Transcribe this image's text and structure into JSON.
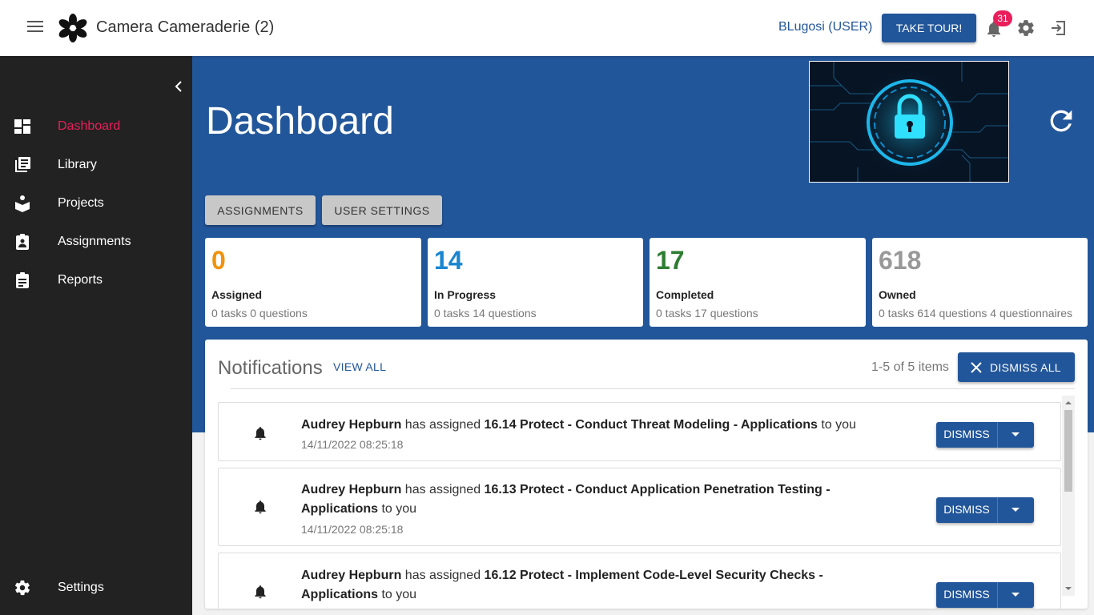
{
  "header": {
    "app_title": "Camera Cameraderie (2)",
    "user_label": "BLugosi (USER)",
    "tour_label": "TAKE TOUR!",
    "notification_count": "31",
    "icons": [
      "menu-icon",
      "logo-icon",
      "bell-icon",
      "settings-gear-icon",
      "logout-icon"
    ]
  },
  "sidebar": {
    "items": [
      {
        "label": "Dashboard",
        "icon": "dashboard-icon",
        "active": true
      },
      {
        "label": "Library",
        "icon": "library-icon",
        "active": false
      },
      {
        "label": "Projects",
        "icon": "projects-icon",
        "active": false
      },
      {
        "label": "Assignments",
        "icon": "assignments-icon",
        "active": false
      },
      {
        "label": "Reports",
        "icon": "reports-icon",
        "active": false
      }
    ],
    "settings_label": "Settings"
  },
  "main": {
    "page_title": "Dashboard",
    "tabs": [
      "ASSIGNMENTS",
      "USER SETTINGS"
    ],
    "stats": [
      {
        "value": "0",
        "label": "Assigned",
        "sub": "0 tasks 0 questions",
        "color": "#f0920a"
      },
      {
        "value": "14",
        "label": "In Progress",
        "sub": "0 tasks 14 questions",
        "color": "#1a86d0"
      },
      {
        "value": "17",
        "label": "Completed",
        "sub": "0 tasks 17 questions",
        "color": "#2e7d32"
      },
      {
        "value": "618",
        "label": "Owned",
        "sub": "0 tasks 614 questions 4 questionnaires",
        "color": "#999999"
      }
    ]
  },
  "notifications": {
    "title": "Notifications",
    "view_all": "VIEW ALL",
    "count_text": "1-5 of 5 items",
    "dismiss_all": "DISMISS ALL",
    "dismiss_label": "DISMISS",
    "connector_assigned": "has assigned",
    "connector_to_you": "to you",
    "items": [
      {
        "user": "Audrey Hepburn",
        "task": "16.14 Protect - Conduct Threat Modeling - Applications",
        "timestamp": "14/11/2022 08:25:18"
      },
      {
        "user": "Audrey Hepburn",
        "task": "16.13 Protect - Conduct Application Penetration Testing - Applications",
        "timestamp": "14/11/2022 08:25:18"
      },
      {
        "user": "Audrey Hepburn",
        "task": "16.12 Protect - Implement Code-Level Security Checks - Applications",
        "timestamp": ""
      }
    ]
  },
  "colors": {
    "primary": "#22569a",
    "accent": "#e91e5a",
    "sidebar": "#222222"
  }
}
